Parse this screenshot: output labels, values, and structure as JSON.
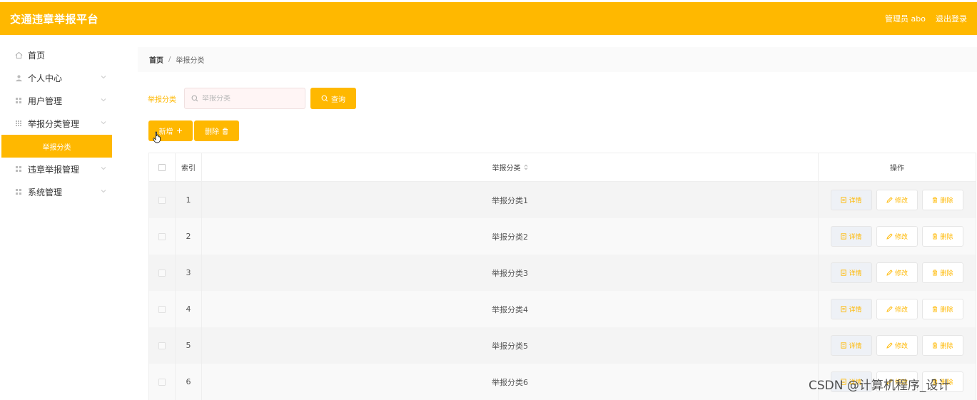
{
  "header": {
    "title": "交通违章举报平台",
    "admin_label": "管理员 abo",
    "logout_label": "退出登录",
    "color": "#ffb800"
  },
  "sidebar": {
    "items": [
      {
        "label": "首页",
        "icon": "home-icon"
      },
      {
        "label": "个人中心",
        "icon": "user-icon"
      },
      {
        "label": "用户管理",
        "icon": "grid-icon"
      },
      {
        "label": "举报分类管理",
        "icon": "grid-icon"
      },
      {
        "label": "违章举报管理",
        "icon": "grid-icon"
      },
      {
        "label": "系统管理",
        "icon": "grid-icon"
      }
    ],
    "active_sub": "举报分类"
  },
  "breadcrumb": {
    "home": "首页",
    "separator": "/",
    "current": "举报分类"
  },
  "search": {
    "label": "举报分类",
    "placeholder": "举报分类",
    "query_label": "查询"
  },
  "actions": {
    "add_label": "新增",
    "delete_label": "删除"
  },
  "table": {
    "headers": {
      "index": "索引",
      "name": "举报分类",
      "ops": "操作"
    },
    "row_buttons": {
      "detail": "详情",
      "edit": "修改",
      "delete": "删除"
    },
    "rows": [
      {
        "index": "1",
        "name": "举报分类1"
      },
      {
        "index": "2",
        "name": "举报分类2"
      },
      {
        "index": "3",
        "name": "举报分类3"
      },
      {
        "index": "4",
        "name": "举报分类4"
      },
      {
        "index": "5",
        "name": "举报分类5"
      },
      {
        "index": "6",
        "name": "举报分类6"
      }
    ]
  },
  "watermark": "CSDN @计算机程序_设计"
}
